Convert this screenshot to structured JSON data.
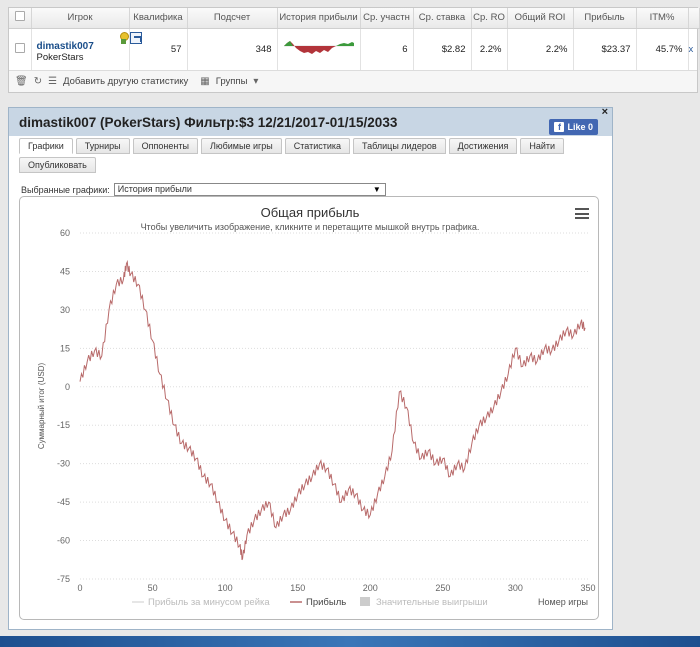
{
  "stats": {
    "columns": [
      "Игрок",
      "Квалифика",
      "Подсчет",
      "История прибыли",
      "Ср. участн",
      "Ср. ставка",
      "Ср. RO",
      "Общий ROI",
      "Прибыль",
      "ITM%"
    ],
    "row": {
      "player_name": "dimastik007",
      "site": "PokerStars",
      "qualifier": "57",
      "count": "348",
      "avg_entrants": "6",
      "avg_stake": "$2.82",
      "avg_roi": "2.2%",
      "total_roi": "2.2%",
      "profit": "$23.37",
      "itm": "45.7%"
    },
    "close": "x",
    "toolbar": {
      "add_stats": "Добавить другую статистику",
      "groups": "Группы"
    }
  },
  "panel": {
    "title": "dimastik007 (PokerStars) Фильтр:$3 12/21/2017-01/15/2033",
    "like_label": "Like 0",
    "close_label": "×",
    "tabs": [
      "Графики",
      "Турниры",
      "Оппоненты",
      "Любимые игры",
      "Статистика",
      "Таблицы лидеров",
      "Достижения",
      "Найти",
      "Опубликовать"
    ],
    "select_label": "Выбранные графики:",
    "select_value": "История прибыли"
  },
  "chart_data": {
    "type": "line",
    "title": "Общая прибыль",
    "subtitle": "Чтобы увеличить изображение, кликните и перетащите мышкой внутрь графика.",
    "xlabel": "Номер игры",
    "ylabel": "Суммарный итог (USD)",
    "xlim": [
      0,
      350
    ],
    "ylim": [
      -75,
      60
    ],
    "xticks": [
      0,
      50,
      100,
      150,
      200,
      250,
      300,
      350
    ],
    "yticks": [
      60,
      45,
      30,
      15,
      0,
      -15,
      -30,
      -45,
      -60,
      -75
    ],
    "grid": true,
    "legend_position": "bottom",
    "legend": [
      "Прибыль за минусом рейка",
      "Прибыль",
      "Значительные выигрыши"
    ],
    "series": [
      {
        "name": "Прибыль",
        "color": "#b86a6a",
        "x": [
          0,
          5,
          10,
          15,
          20,
          25,
          30,
          32,
          35,
          40,
          45,
          50,
          55,
          60,
          65,
          70,
          75,
          80,
          85,
          90,
          95,
          100,
          105,
          110,
          112,
          115,
          120,
          125,
          130,
          135,
          140,
          145,
          150,
          155,
          160,
          165,
          170,
          175,
          180,
          185,
          190,
          195,
          200,
          205,
          210,
          215,
          220,
          225,
          230,
          235,
          240,
          245,
          250,
          255,
          260,
          265,
          270,
          275,
          280,
          285,
          290,
          295,
          300,
          305,
          310,
          315,
          320,
          325,
          330,
          335,
          340,
          345,
          348
        ],
        "values": [
          2,
          10,
          14,
          12,
          30,
          40,
          42,
          48,
          44,
          40,
          30,
          18,
          5,
          -5,
          -15,
          -22,
          -24,
          -28,
          -35,
          -38,
          -45,
          -52,
          -57,
          -62,
          -67,
          -58,
          -52,
          -48,
          -45,
          -55,
          -50,
          -48,
          -42,
          -38,
          -35,
          -30,
          -32,
          -38,
          -45,
          -40,
          -42,
          -48,
          -50,
          -42,
          -35,
          -25,
          -2,
          -8,
          -22,
          -28,
          -25,
          -30,
          -28,
          -35,
          -30,
          -32,
          -22,
          -15,
          -12,
          -8,
          -2,
          5,
          15,
          8,
          12,
          10,
          15,
          14,
          18,
          22,
          20,
          25,
          23
        ]
      }
    ]
  }
}
